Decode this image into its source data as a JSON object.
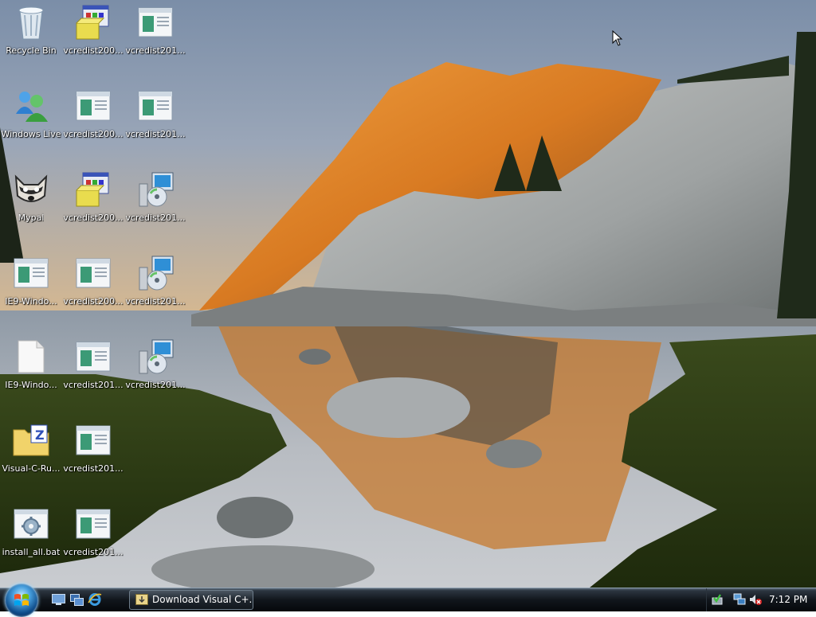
{
  "desktop": {
    "icons": [
      {
        "label": "Recycle Bin",
        "icon": "recycle-bin-icon"
      },
      {
        "label": "Windows Live",
        "icon": "windows-live-icon"
      },
      {
        "label": "Mypal",
        "icon": "mypal-icon"
      },
      {
        "label": "IE9-Windo...",
        "icon": "window-app-icon"
      },
      {
        "label": "IE9-Windo...",
        "icon": "blank-file-icon"
      },
      {
        "label": "Visual-C-Ru...",
        "icon": "zip-folder-icon"
      },
      {
        "label": "install_all.bat",
        "icon": "batch-file-icon"
      },
      {
        "label": "vcredist200...",
        "icon": "installer-package-icon"
      },
      {
        "label": "vcredist200...",
        "icon": "window-app-icon"
      },
      {
        "label": "vcredist200...",
        "icon": "installer-package-icon"
      },
      {
        "label": "vcredist200...",
        "icon": "window-app-icon"
      },
      {
        "label": "vcredist201...",
        "icon": "window-app-icon"
      },
      {
        "label": "vcredist201...",
        "icon": "window-app-icon"
      },
      {
        "label": "vcredist201...",
        "icon": "window-app-icon"
      },
      {
        "label": "vcredist201...",
        "icon": "window-app-icon"
      },
      {
        "label": "vcredist201...",
        "icon": "window-app-icon"
      },
      {
        "label": "vcredist201...",
        "icon": "setup-cd-icon"
      },
      {
        "label": "vcredist201...",
        "icon": "setup-cd-icon"
      },
      {
        "label": "vcredist201...",
        "icon": "setup-cd-icon"
      }
    ]
  },
  "taskbar": {
    "start_icon": "windows-start-orb-icon",
    "quick_launch": [
      {
        "icon": "show-desktop-icon"
      },
      {
        "icon": "switch-windows-icon"
      },
      {
        "icon": "internet-explorer-icon"
      }
    ],
    "task_button": {
      "label": "Download Visual C+...",
      "icon": "download-window-icon"
    },
    "tray": [
      {
        "icon": "safely-remove-hardware-icon"
      },
      {
        "icon": "network-icon"
      },
      {
        "icon": "volume-muted-icon"
      }
    ],
    "clock": "7:12 PM"
  },
  "colors": {
    "taskbar": "#0b1015",
    "label_text": "#ffffff",
    "start_orb": "#2f7fc4"
  }
}
